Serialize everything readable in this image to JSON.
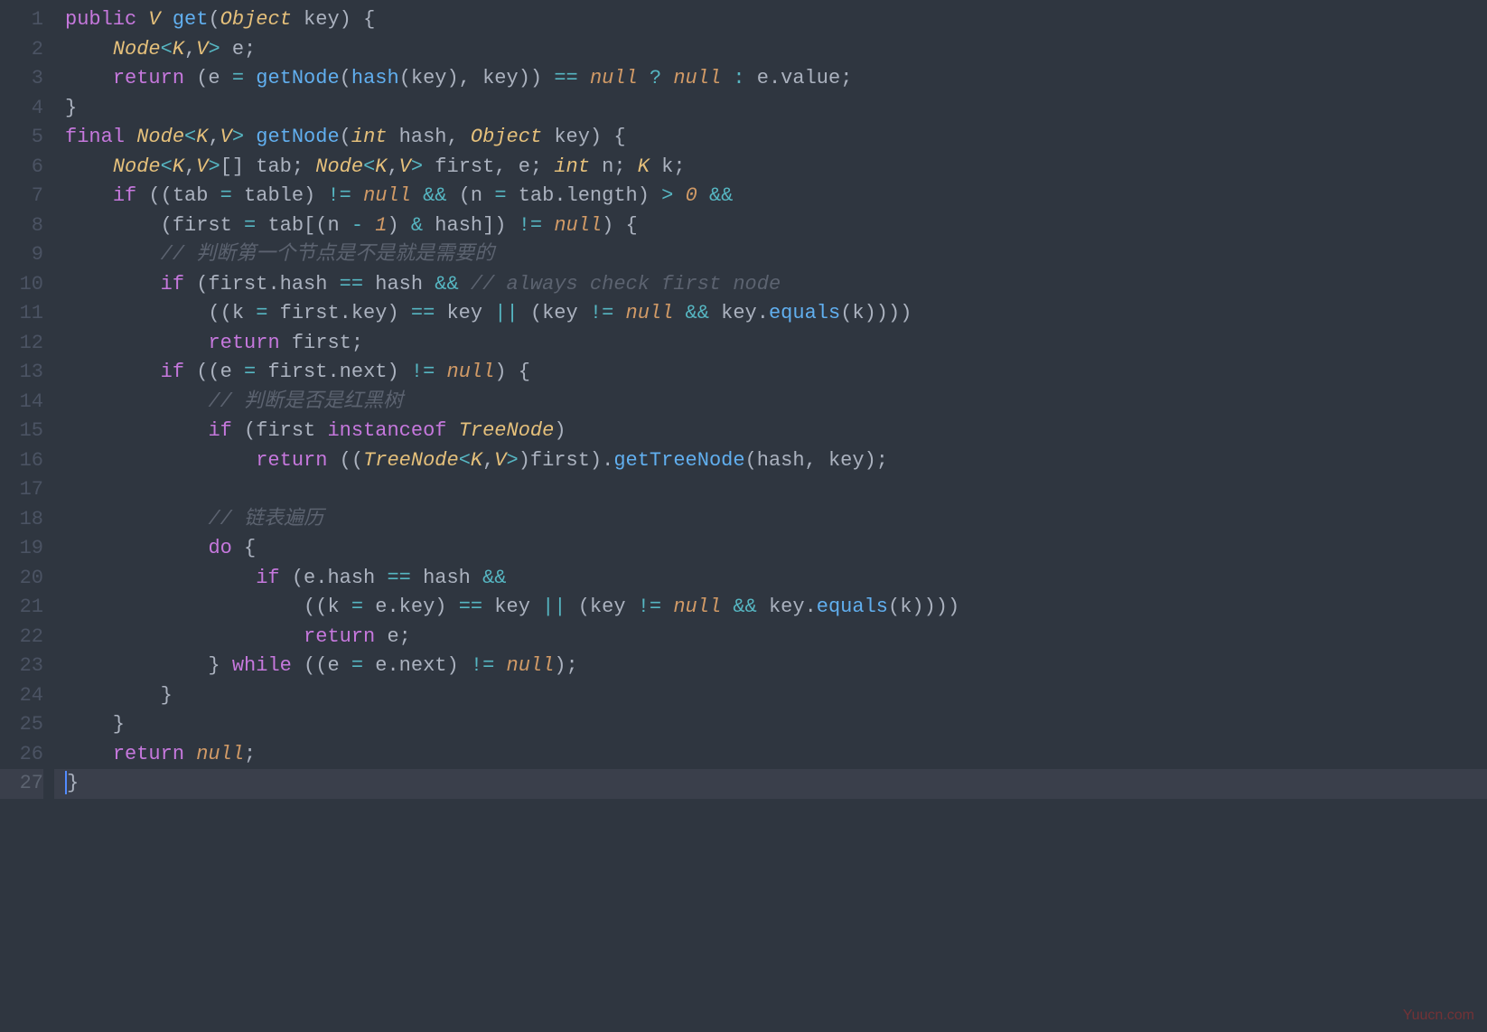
{
  "watermark": "Yuucn.com",
  "current_line": 27,
  "lines": [
    {
      "num": 1,
      "tokens": [
        {
          "t": "public ",
          "c": "kw"
        },
        {
          "t": "V",
          "c": "type"
        },
        {
          "t": " ",
          "c": "plain"
        },
        {
          "t": "get",
          "c": "fn"
        },
        {
          "t": "(",
          "c": "punc"
        },
        {
          "t": "Object",
          "c": "type"
        },
        {
          "t": " key) {",
          "c": "plain"
        }
      ]
    },
    {
      "num": 2,
      "tokens": [
        {
          "t": "    ",
          "c": "plain"
        },
        {
          "t": "Node",
          "c": "type"
        },
        {
          "t": "<",
          "c": "op"
        },
        {
          "t": "K",
          "c": "type"
        },
        {
          "t": ",",
          "c": "plain"
        },
        {
          "t": "V",
          "c": "type"
        },
        {
          "t": ">",
          "c": "op"
        },
        {
          "t": " e;",
          "c": "plain"
        }
      ]
    },
    {
      "num": 3,
      "tokens": [
        {
          "t": "    ",
          "c": "plain"
        },
        {
          "t": "return",
          "c": "kw"
        },
        {
          "t": " (e ",
          "c": "plain"
        },
        {
          "t": "=",
          "c": "op"
        },
        {
          "t": " ",
          "c": "plain"
        },
        {
          "t": "getNode",
          "c": "fn"
        },
        {
          "t": "(",
          "c": "punc"
        },
        {
          "t": "hash",
          "c": "fn"
        },
        {
          "t": "(key), key)) ",
          "c": "plain"
        },
        {
          "t": "==",
          "c": "op"
        },
        {
          "t": " ",
          "c": "plain"
        },
        {
          "t": "null",
          "c": "lit"
        },
        {
          "t": " ",
          "c": "plain"
        },
        {
          "t": "?",
          "c": "op"
        },
        {
          "t": " ",
          "c": "plain"
        },
        {
          "t": "null",
          "c": "lit"
        },
        {
          "t": " ",
          "c": "plain"
        },
        {
          "t": ":",
          "c": "op"
        },
        {
          "t": " e.value;",
          "c": "plain"
        }
      ]
    },
    {
      "num": 4,
      "tokens": [
        {
          "t": "}",
          "c": "plain"
        }
      ]
    },
    {
      "num": 5,
      "tokens": [
        {
          "t": "final ",
          "c": "kw"
        },
        {
          "t": "Node",
          "c": "type"
        },
        {
          "t": "<",
          "c": "op"
        },
        {
          "t": "K",
          "c": "type"
        },
        {
          "t": ",",
          "c": "plain"
        },
        {
          "t": "V",
          "c": "type"
        },
        {
          "t": ">",
          "c": "op"
        },
        {
          "t": " ",
          "c": "plain"
        },
        {
          "t": "getNode",
          "c": "fn"
        },
        {
          "t": "(",
          "c": "punc"
        },
        {
          "t": "int",
          "c": "type"
        },
        {
          "t": " hash, ",
          "c": "plain"
        },
        {
          "t": "Object",
          "c": "type"
        },
        {
          "t": " key) {",
          "c": "plain"
        }
      ]
    },
    {
      "num": 6,
      "tokens": [
        {
          "t": "    ",
          "c": "plain"
        },
        {
          "t": "Node",
          "c": "type"
        },
        {
          "t": "<",
          "c": "op"
        },
        {
          "t": "K",
          "c": "type"
        },
        {
          "t": ",",
          "c": "plain"
        },
        {
          "t": "V",
          "c": "type"
        },
        {
          "t": ">",
          "c": "op"
        },
        {
          "t": "[] tab; ",
          "c": "plain"
        },
        {
          "t": "Node",
          "c": "type"
        },
        {
          "t": "<",
          "c": "op"
        },
        {
          "t": "K",
          "c": "type"
        },
        {
          "t": ",",
          "c": "plain"
        },
        {
          "t": "V",
          "c": "type"
        },
        {
          "t": ">",
          "c": "op"
        },
        {
          "t": " first, e; ",
          "c": "plain"
        },
        {
          "t": "int",
          "c": "type"
        },
        {
          "t": " n; ",
          "c": "plain"
        },
        {
          "t": "K",
          "c": "type"
        },
        {
          "t": " k;",
          "c": "plain"
        }
      ]
    },
    {
      "num": 7,
      "tokens": [
        {
          "t": "    ",
          "c": "plain"
        },
        {
          "t": "if",
          "c": "kw"
        },
        {
          "t": " ((tab ",
          "c": "plain"
        },
        {
          "t": "=",
          "c": "op"
        },
        {
          "t": " table) ",
          "c": "plain"
        },
        {
          "t": "!=",
          "c": "op"
        },
        {
          "t": " ",
          "c": "plain"
        },
        {
          "t": "null",
          "c": "lit"
        },
        {
          "t": " ",
          "c": "plain"
        },
        {
          "t": "&&",
          "c": "op"
        },
        {
          "t": " (n ",
          "c": "plain"
        },
        {
          "t": "=",
          "c": "op"
        },
        {
          "t": " tab.length) ",
          "c": "plain"
        },
        {
          "t": ">",
          "c": "op"
        },
        {
          "t": " ",
          "c": "plain"
        },
        {
          "t": "0",
          "c": "lit"
        },
        {
          "t": " ",
          "c": "plain"
        },
        {
          "t": "&&",
          "c": "op"
        }
      ]
    },
    {
      "num": 8,
      "tokens": [
        {
          "t": "        (first ",
          "c": "plain"
        },
        {
          "t": "=",
          "c": "op"
        },
        {
          "t": " tab[(n ",
          "c": "plain"
        },
        {
          "t": "-",
          "c": "op"
        },
        {
          "t": " ",
          "c": "plain"
        },
        {
          "t": "1",
          "c": "lit"
        },
        {
          "t": ") ",
          "c": "plain"
        },
        {
          "t": "&",
          "c": "op"
        },
        {
          "t": " hash]) ",
          "c": "plain"
        },
        {
          "t": "!=",
          "c": "op"
        },
        {
          "t": " ",
          "c": "plain"
        },
        {
          "t": "null",
          "c": "lit"
        },
        {
          "t": ") {",
          "c": "plain"
        }
      ]
    },
    {
      "num": 9,
      "tokens": [
        {
          "t": "        ",
          "c": "plain"
        },
        {
          "t": "// 判断第一个节点是不是就是需要的",
          "c": "cmt"
        }
      ]
    },
    {
      "num": 10,
      "tokens": [
        {
          "t": "        ",
          "c": "plain"
        },
        {
          "t": "if",
          "c": "kw"
        },
        {
          "t": " (first.hash ",
          "c": "plain"
        },
        {
          "t": "==",
          "c": "op"
        },
        {
          "t": " hash ",
          "c": "plain"
        },
        {
          "t": "&&",
          "c": "op"
        },
        {
          "t": " ",
          "c": "plain"
        },
        {
          "t": "// always check first node",
          "c": "cmt"
        }
      ]
    },
    {
      "num": 11,
      "tokens": [
        {
          "t": "            ((k ",
          "c": "plain"
        },
        {
          "t": "=",
          "c": "op"
        },
        {
          "t": " first.key) ",
          "c": "plain"
        },
        {
          "t": "==",
          "c": "op"
        },
        {
          "t": " key ",
          "c": "plain"
        },
        {
          "t": "||",
          "c": "op"
        },
        {
          "t": " (key ",
          "c": "plain"
        },
        {
          "t": "!=",
          "c": "op"
        },
        {
          "t": " ",
          "c": "plain"
        },
        {
          "t": "null",
          "c": "lit"
        },
        {
          "t": " ",
          "c": "plain"
        },
        {
          "t": "&&",
          "c": "op"
        },
        {
          "t": " key.",
          "c": "plain"
        },
        {
          "t": "equals",
          "c": "fn"
        },
        {
          "t": "(k))))",
          "c": "plain"
        }
      ]
    },
    {
      "num": 12,
      "tokens": [
        {
          "t": "            ",
          "c": "plain"
        },
        {
          "t": "return",
          "c": "kw"
        },
        {
          "t": " first;",
          "c": "plain"
        }
      ]
    },
    {
      "num": 13,
      "tokens": [
        {
          "t": "        ",
          "c": "plain"
        },
        {
          "t": "if",
          "c": "kw"
        },
        {
          "t": " ((e ",
          "c": "plain"
        },
        {
          "t": "=",
          "c": "op"
        },
        {
          "t": " first.next) ",
          "c": "plain"
        },
        {
          "t": "!=",
          "c": "op"
        },
        {
          "t": " ",
          "c": "plain"
        },
        {
          "t": "null",
          "c": "lit"
        },
        {
          "t": ") {",
          "c": "plain"
        }
      ]
    },
    {
      "num": 14,
      "tokens": [
        {
          "t": "            ",
          "c": "plain"
        },
        {
          "t": "// 判断是否是红黑树",
          "c": "cmt"
        }
      ]
    },
    {
      "num": 15,
      "tokens": [
        {
          "t": "            ",
          "c": "plain"
        },
        {
          "t": "if",
          "c": "kw"
        },
        {
          "t": " (first ",
          "c": "plain"
        },
        {
          "t": "instanceof",
          "c": "kw"
        },
        {
          "t": " ",
          "c": "plain"
        },
        {
          "t": "TreeNode",
          "c": "type"
        },
        {
          "t": ")",
          "c": "plain"
        }
      ]
    },
    {
      "num": 16,
      "tokens": [
        {
          "t": "                ",
          "c": "plain"
        },
        {
          "t": "return",
          "c": "kw"
        },
        {
          "t": " ((",
          "c": "plain"
        },
        {
          "t": "TreeNode",
          "c": "type"
        },
        {
          "t": "<",
          "c": "op"
        },
        {
          "t": "K",
          "c": "type"
        },
        {
          "t": ",",
          "c": "plain"
        },
        {
          "t": "V",
          "c": "type"
        },
        {
          "t": ">",
          "c": "op"
        },
        {
          "t": ")first).",
          "c": "plain"
        },
        {
          "t": "getTreeNode",
          "c": "fn"
        },
        {
          "t": "(hash, key);",
          "c": "plain"
        }
      ]
    },
    {
      "num": 17,
      "tokens": []
    },
    {
      "num": 18,
      "tokens": [
        {
          "t": "            ",
          "c": "plain"
        },
        {
          "t": "// 链表遍历",
          "c": "cmt"
        }
      ]
    },
    {
      "num": 19,
      "tokens": [
        {
          "t": "            ",
          "c": "plain"
        },
        {
          "t": "do",
          "c": "kw"
        },
        {
          "t": " {",
          "c": "plain"
        }
      ]
    },
    {
      "num": 20,
      "tokens": [
        {
          "t": "                ",
          "c": "plain"
        },
        {
          "t": "if",
          "c": "kw"
        },
        {
          "t": " (e.hash ",
          "c": "plain"
        },
        {
          "t": "==",
          "c": "op"
        },
        {
          "t": " hash ",
          "c": "plain"
        },
        {
          "t": "&&",
          "c": "op"
        }
      ]
    },
    {
      "num": 21,
      "tokens": [
        {
          "t": "                    ((k ",
          "c": "plain"
        },
        {
          "t": "=",
          "c": "op"
        },
        {
          "t": " e.key) ",
          "c": "plain"
        },
        {
          "t": "==",
          "c": "op"
        },
        {
          "t": " key ",
          "c": "plain"
        },
        {
          "t": "||",
          "c": "op"
        },
        {
          "t": " (key ",
          "c": "plain"
        },
        {
          "t": "!=",
          "c": "op"
        },
        {
          "t": " ",
          "c": "plain"
        },
        {
          "t": "null",
          "c": "lit"
        },
        {
          "t": " ",
          "c": "plain"
        },
        {
          "t": "&&",
          "c": "op"
        },
        {
          "t": " key.",
          "c": "plain"
        },
        {
          "t": "equals",
          "c": "fn"
        },
        {
          "t": "(k))))",
          "c": "plain"
        }
      ]
    },
    {
      "num": 22,
      "tokens": [
        {
          "t": "                    ",
          "c": "plain"
        },
        {
          "t": "return",
          "c": "kw"
        },
        {
          "t": " e;",
          "c": "plain"
        }
      ]
    },
    {
      "num": 23,
      "tokens": [
        {
          "t": "            } ",
          "c": "plain"
        },
        {
          "t": "while",
          "c": "kw"
        },
        {
          "t": " ((e ",
          "c": "plain"
        },
        {
          "t": "=",
          "c": "op"
        },
        {
          "t": " e.next) ",
          "c": "plain"
        },
        {
          "t": "!=",
          "c": "op"
        },
        {
          "t": " ",
          "c": "plain"
        },
        {
          "t": "null",
          "c": "lit"
        },
        {
          "t": ");",
          "c": "plain"
        }
      ]
    },
    {
      "num": 24,
      "tokens": [
        {
          "t": "        }",
          "c": "plain"
        }
      ]
    },
    {
      "num": 25,
      "tokens": [
        {
          "t": "    }",
          "c": "plain"
        }
      ]
    },
    {
      "num": 26,
      "tokens": [
        {
          "t": "    ",
          "c": "plain"
        },
        {
          "t": "return",
          "c": "kw"
        },
        {
          "t": " ",
          "c": "plain"
        },
        {
          "t": "null",
          "c": "lit"
        },
        {
          "t": ";",
          "c": "plain"
        }
      ]
    },
    {
      "num": 27,
      "tokens": [
        {
          "t": "}",
          "c": "plain"
        }
      ]
    }
  ]
}
